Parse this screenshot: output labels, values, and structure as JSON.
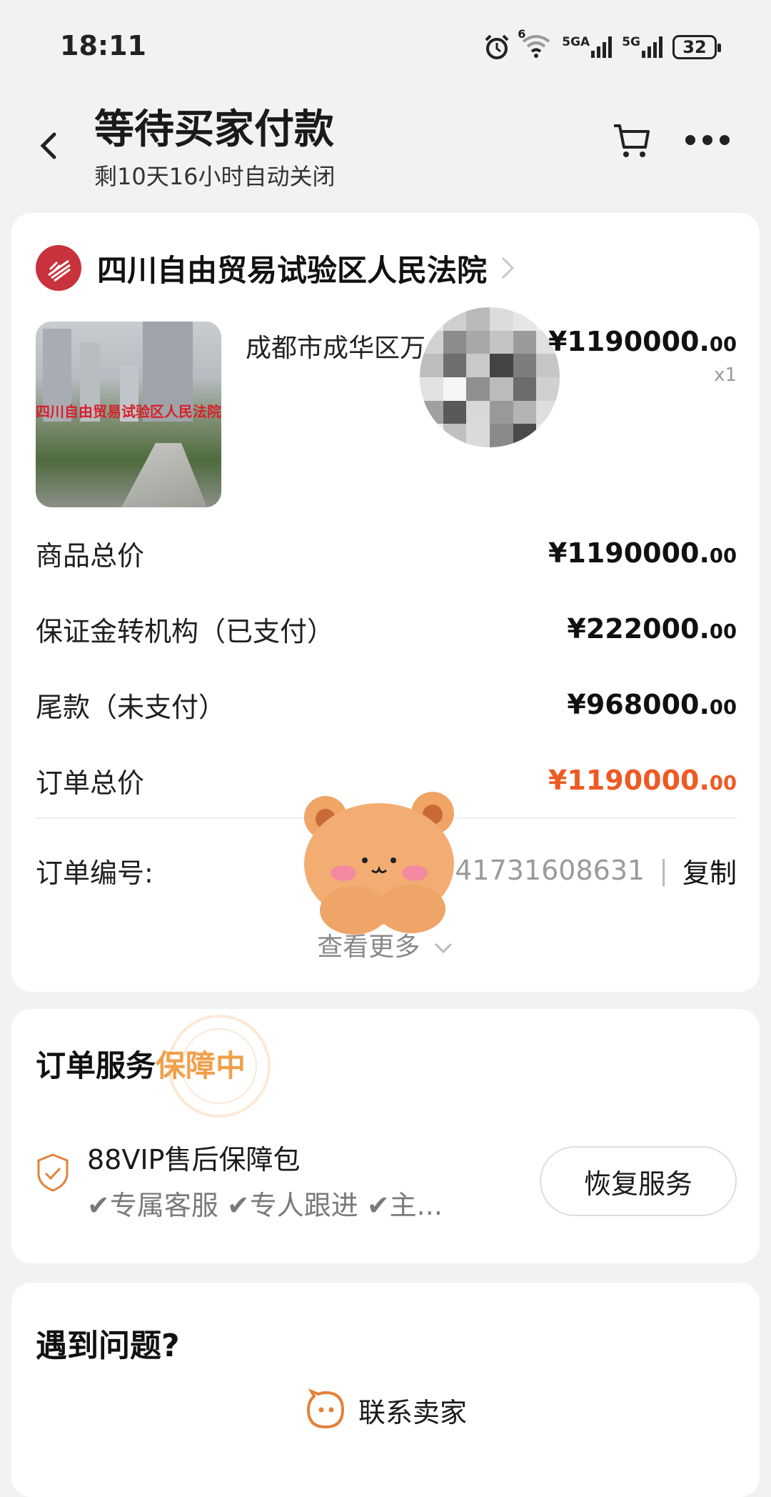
{
  "status_bar": {
    "time": "18:11",
    "wifi_badge": "6",
    "sim1_label": "5GA",
    "sim2_label": "5G",
    "battery": "32"
  },
  "header": {
    "title": "等待买家付款",
    "subtitle": "剩10天16小时自动关闭"
  },
  "shop": {
    "name": "四川自由贸易试验区人民法院"
  },
  "product": {
    "title": "成都市成华区万",
    "banner_text": "四川自由贸易试验区人民法院",
    "price_main": "¥1190000.",
    "price_cents": "00",
    "quantity": "x1"
  },
  "summary": [
    {
      "label": "商品总价",
      "amount": "¥1190000.",
      "cents": "00"
    },
    {
      "label": "保证金转机构（已支付）",
      "amount": "¥222000.",
      "cents": "00"
    },
    {
      "label": "尾款（未支付）",
      "amount": "¥968000.",
      "cents": "00"
    },
    {
      "label": "订单总价",
      "amount": "¥1190000.",
      "cents": "00"
    }
  ],
  "order_no": {
    "label": "订单编号:",
    "number_visible": "741731608631",
    "separator": "|",
    "copy_label": "复制"
  },
  "view_more": "查看更多",
  "service": {
    "title_prefix": "订单服务",
    "title_highlight": "保障中",
    "package_name": "88VIP售后保障包",
    "features": "✔专属客服 ✔专人跟进 ✔主...",
    "restore_button": "恢复服务"
  },
  "help": {
    "title": "遇到问题?",
    "contact_label": "联系卖家"
  },
  "colors": {
    "accent_orange": "#ee5a24",
    "highlight_yellow": "#f0a04b",
    "court_red": "#c8323a"
  },
  "icons": [
    "back-arrow-icon",
    "cart-icon",
    "more-icon",
    "court-logo-icon",
    "chevron-right-icon",
    "shield-check-icon",
    "chat-face-icon",
    "chevron-down-icon"
  ]
}
